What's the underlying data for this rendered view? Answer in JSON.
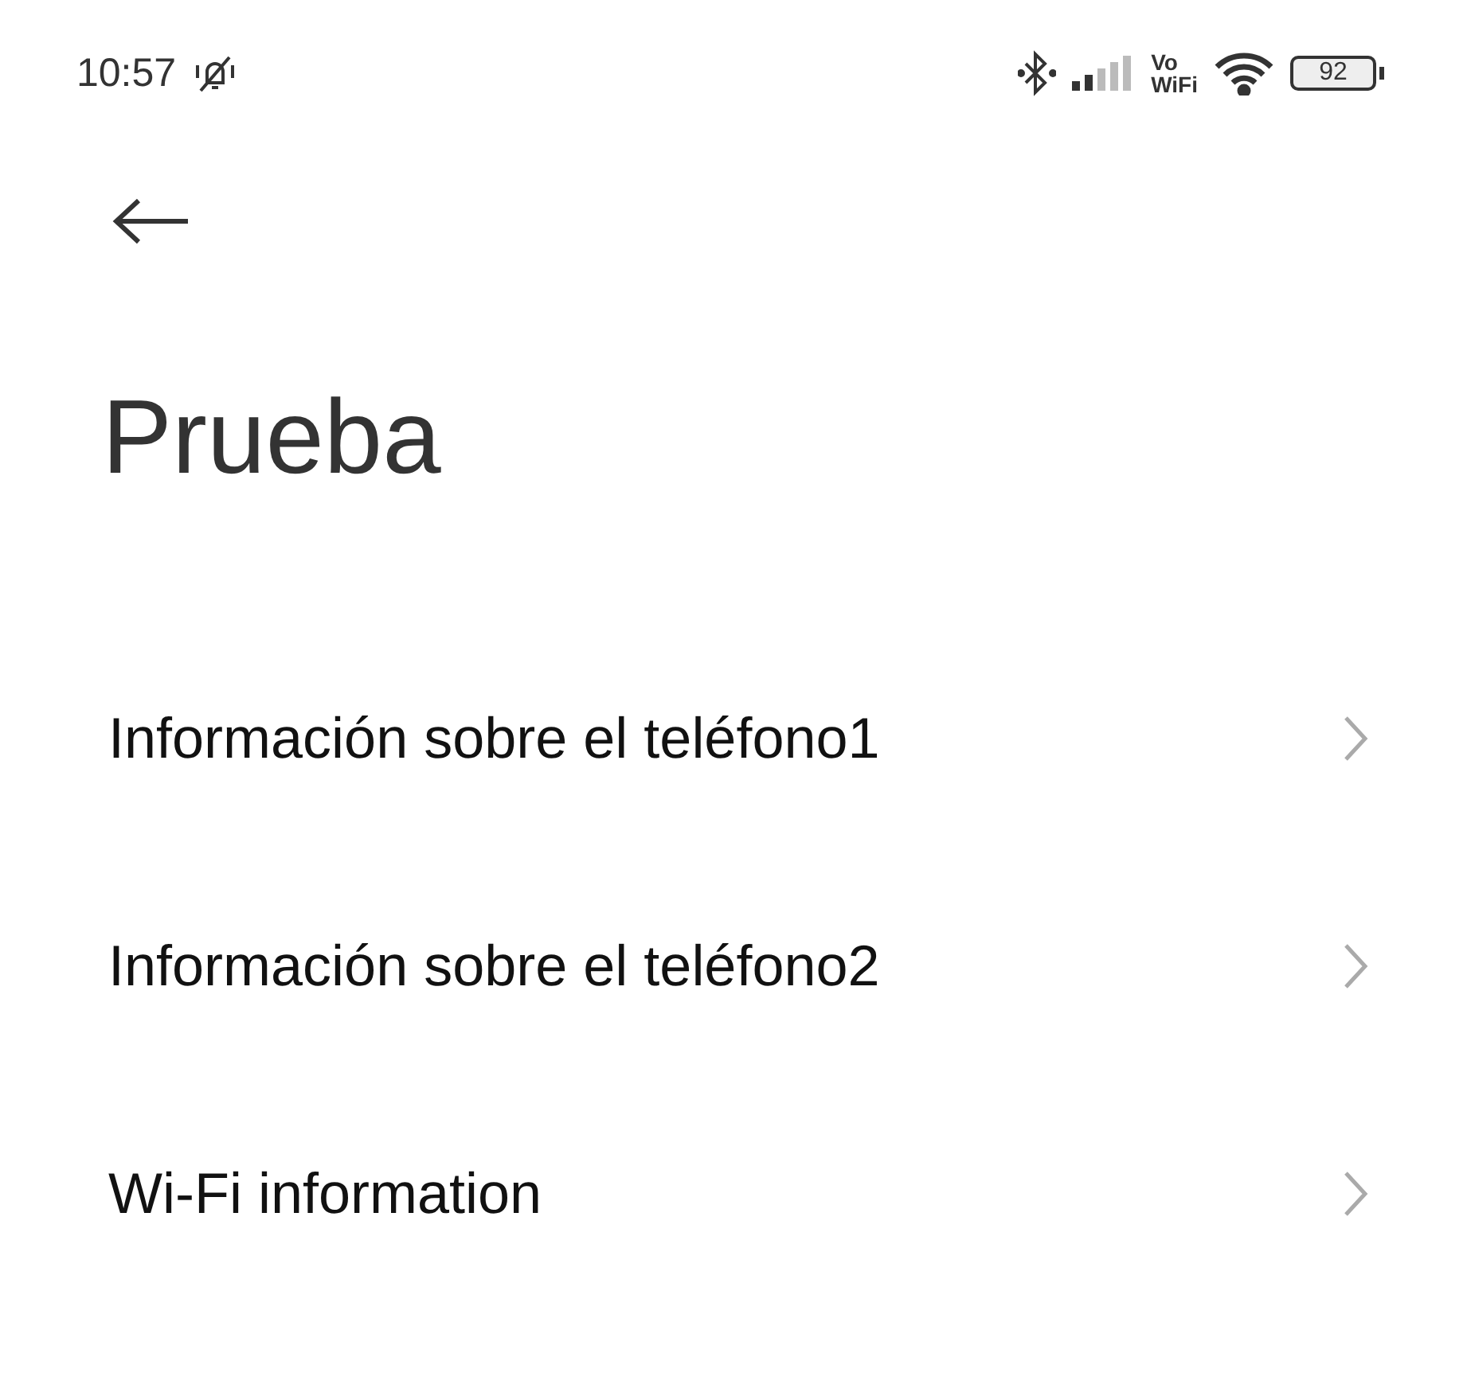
{
  "status_bar": {
    "time": "10:57",
    "vowifi": [
      "Vo",
      "WiFi"
    ],
    "battery": "92"
  },
  "title": "Prueba",
  "items": [
    {
      "label": "Información sobre el teléfono1"
    },
    {
      "label": "Información sobre el teléfono2"
    },
    {
      "label": "Wi-Fi information"
    }
  ]
}
